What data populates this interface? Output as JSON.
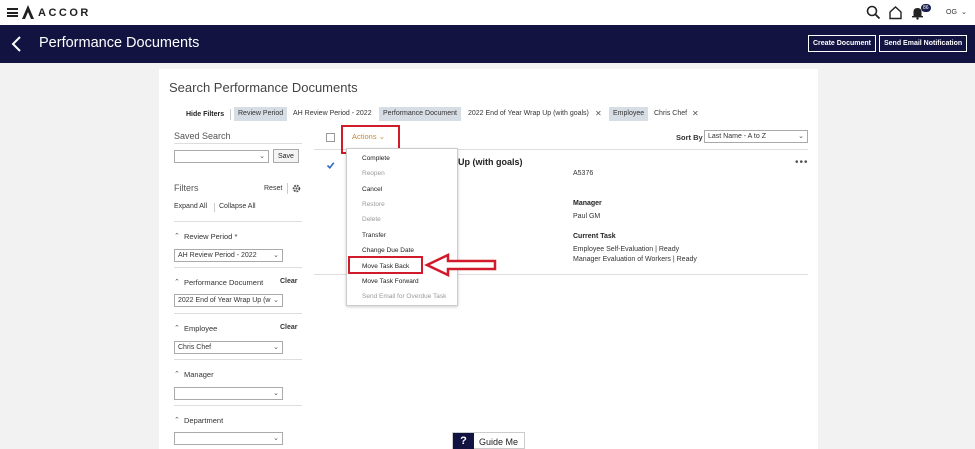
{
  "brand": {
    "name": "ACCOR"
  },
  "topbar": {
    "notification_count": "86",
    "user_initials": "OG"
  },
  "header": {
    "title": "Performance Documents",
    "create_button": "Create Document",
    "send_email_button": "Send Email Notification"
  },
  "search": {
    "title": "Search Performance Documents",
    "hide_filters": "Hide Filters",
    "chips": [
      {
        "label": "Review Period",
        "value": "AH Review Period - 2022"
      },
      {
        "label": "Performance Document",
        "value": "2022 End of Year Wrap Up (with goals)"
      },
      {
        "label": "Employee",
        "value": "Chris Chef"
      }
    ]
  },
  "sidebar": {
    "saved_search_label": "Saved Search",
    "save_button": "Save",
    "filters_label": "Filters",
    "reset": "Reset",
    "expand_all": "Expand All",
    "collapse_all": "Collapse All",
    "filters": [
      {
        "label": "Review Period *",
        "value": "AH Review Period - 2022",
        "clear": ""
      },
      {
        "label": "Performance Document",
        "value": "2022 End of Year Wrap Up (w",
        "clear": "Clear"
      },
      {
        "label": "Employee",
        "value": "Chris Chef",
        "clear": "Clear"
      },
      {
        "label": "Manager",
        "value": "",
        "clear": ""
      },
      {
        "label": "Department",
        "value": "",
        "clear": ""
      }
    ]
  },
  "results": {
    "actions_label": "Actions",
    "sort_by_label": "Sort By",
    "sort_value": "Last Name - A to Z",
    "doc_title": "Up (with goals)",
    "doc_id": "A5376",
    "manager_label": "Manager",
    "manager_value": "Paul GM",
    "current_task_label": "Current Task",
    "current_task_1": "Employee Self-Evaluation | Ready",
    "current_task_2": "Manager Evaluation of Workers | Ready"
  },
  "actions_menu": {
    "items": [
      {
        "label": "Complete",
        "enabled": true
      },
      {
        "label": "Reopen",
        "enabled": false
      },
      {
        "label": "Cancel",
        "enabled": true
      },
      {
        "label": "Restore",
        "enabled": false
      },
      {
        "label": "Delete",
        "enabled": false
      },
      {
        "label": "Transfer",
        "enabled": true
      },
      {
        "label": "Change Due Date",
        "enabled": true
      },
      {
        "label": "Move Task Back",
        "enabled": true
      },
      {
        "label": "Move Task Forward",
        "enabled": true
      },
      {
        "label": "Send Email for Overdue Task",
        "enabled": false
      }
    ]
  },
  "guide": {
    "label": "Guide Me",
    "icon_text": "?"
  },
  "colors": {
    "navy": "#121341",
    "highlight_red": "#d11a2a",
    "actions_orange": "#c98a3a"
  }
}
